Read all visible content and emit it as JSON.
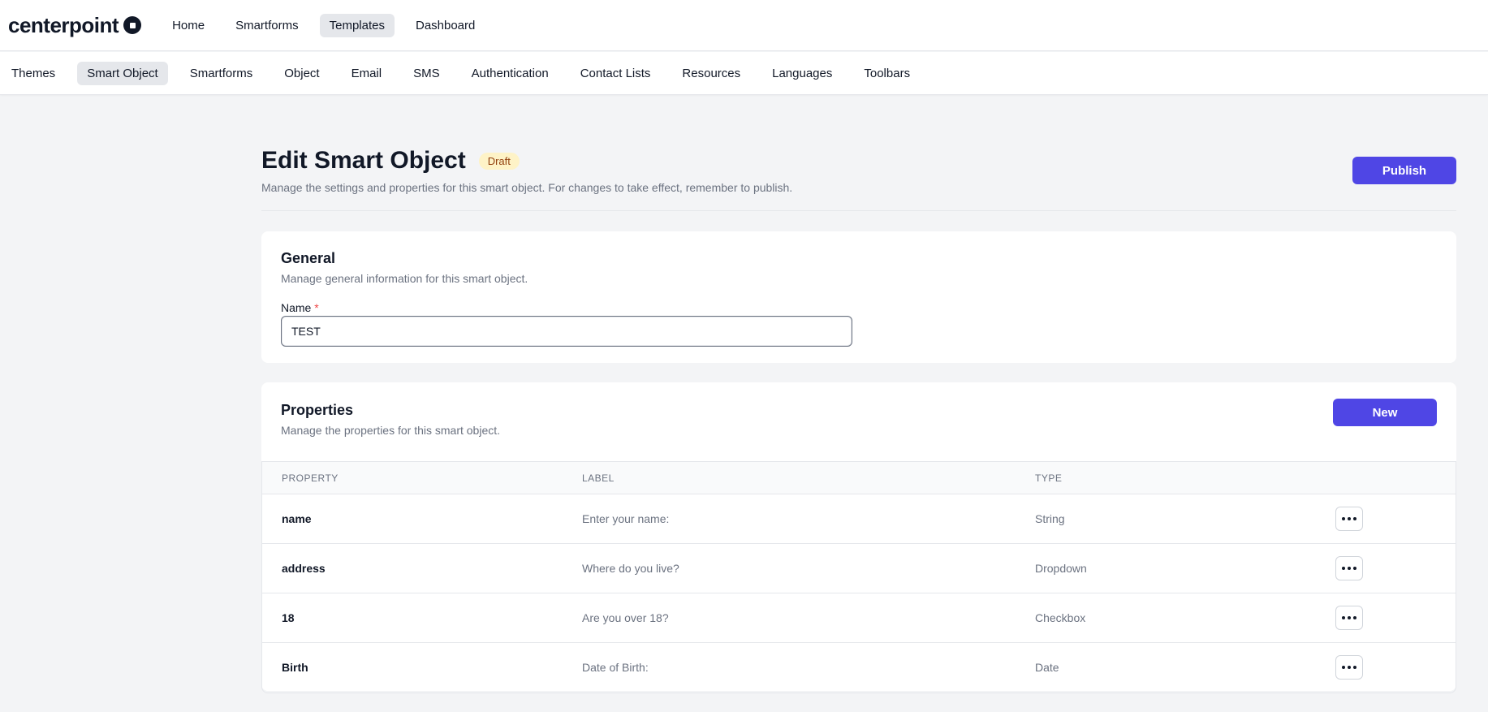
{
  "brand": {
    "name": "centerpoint"
  },
  "topnav": {
    "items": [
      {
        "label": "Home",
        "active": false
      },
      {
        "label": "Smartforms",
        "active": false
      },
      {
        "label": "Templates",
        "active": true
      },
      {
        "label": "Dashboard",
        "active": false
      }
    ]
  },
  "subnav": {
    "items": [
      {
        "label": "Themes",
        "active": false
      },
      {
        "label": "Smart Object",
        "active": true
      },
      {
        "label": "Smartforms",
        "active": false
      },
      {
        "label": "Object",
        "active": false
      },
      {
        "label": "Email",
        "active": false
      },
      {
        "label": "SMS",
        "active": false
      },
      {
        "label": "Authentication",
        "active": false
      },
      {
        "label": "Contact Lists",
        "active": false
      },
      {
        "label": "Resources",
        "active": false
      },
      {
        "label": "Languages",
        "active": false
      },
      {
        "label": "Toolbars",
        "active": false
      }
    ]
  },
  "page": {
    "title": "Edit Smart Object",
    "status_badge": "Draft",
    "subtitle": "Manage the settings and properties for this smart object. For changes to take effect, remember to publish.",
    "publish_label": "Publish"
  },
  "general": {
    "title": "General",
    "description": "Manage general information for this smart object.",
    "name_label": "Name",
    "required_mark": "*",
    "name_value": "TEST"
  },
  "properties": {
    "title": "Properties",
    "description": "Manage the properties for this smart object.",
    "new_label": "New",
    "columns": [
      "PROPERTY",
      "LABEL",
      "TYPE"
    ],
    "rows": [
      {
        "property": "name",
        "label": "Enter your name:",
        "type": "String"
      },
      {
        "property": "address",
        "label": "Where do you live?",
        "type": "Dropdown"
      },
      {
        "property": "18",
        "label": "Are you over 18?",
        "type": "Checkbox"
      },
      {
        "property": "Birth",
        "label": "Date of Birth:",
        "type": "Date"
      }
    ]
  },
  "colors": {
    "accent": "#4f46e5",
    "badge_bg": "#fef3c7",
    "badge_text": "#92400e",
    "required": "#ef4444"
  },
  "icons": {
    "brand": "circle-square-logo-icon",
    "row_actions": "more-horizontal-icon"
  }
}
